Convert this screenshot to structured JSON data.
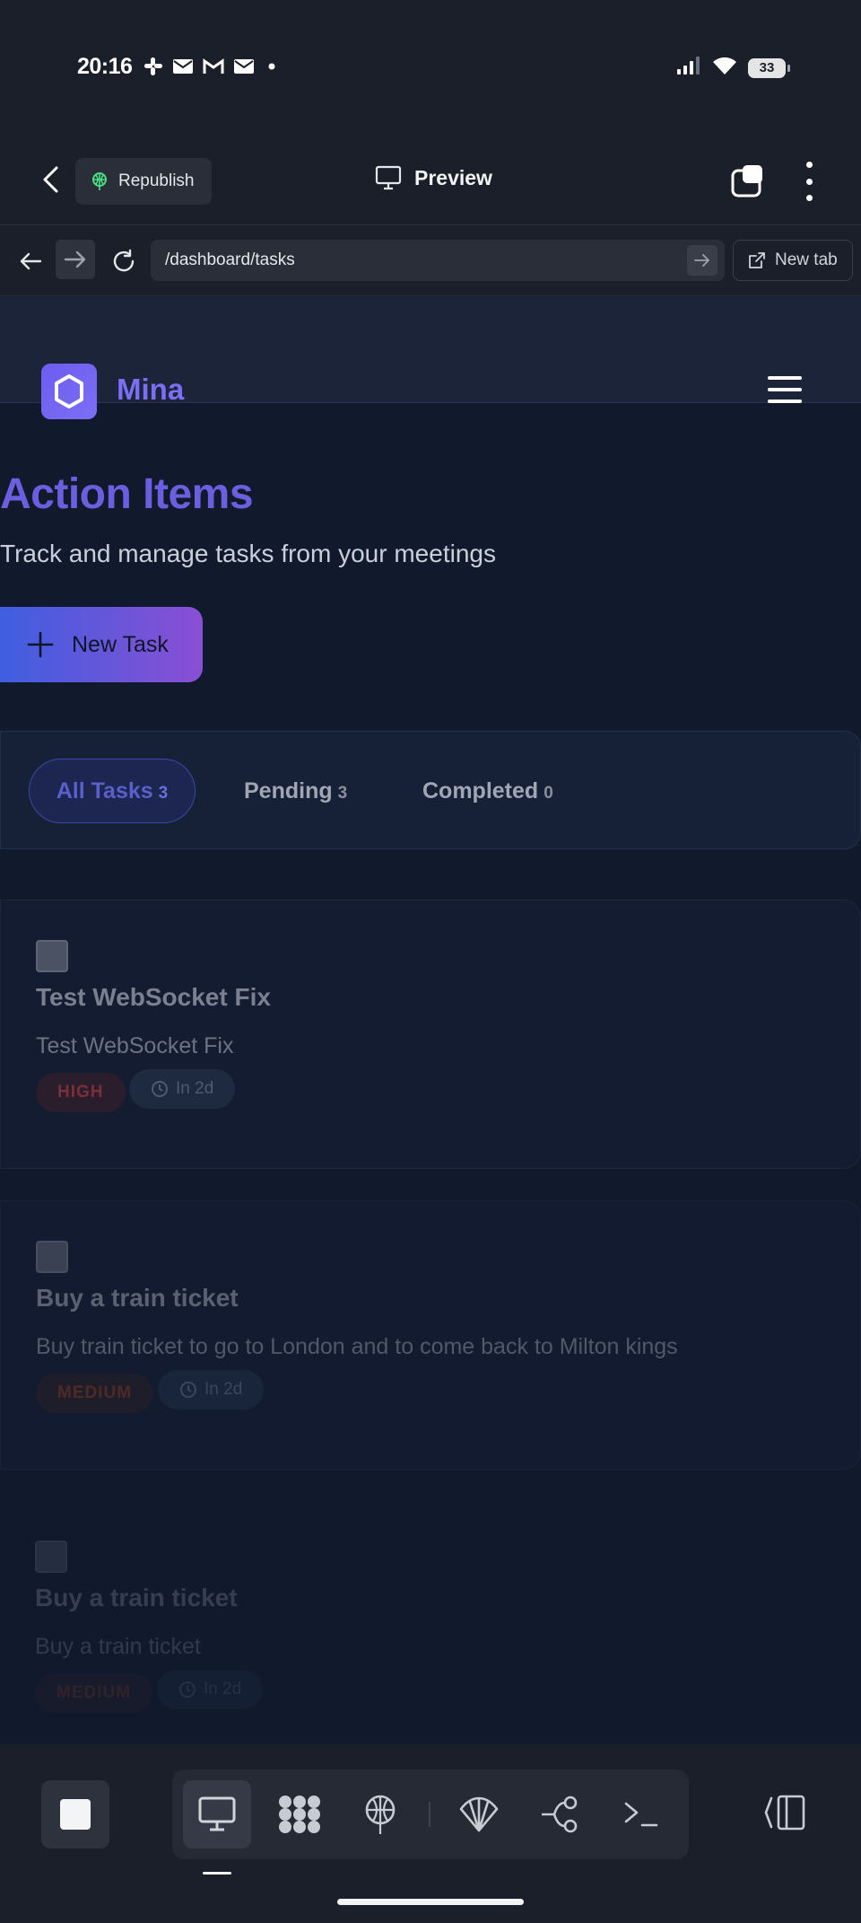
{
  "status_bar": {
    "time": "20:16",
    "battery": "33"
  },
  "app_header": {
    "republish_label": "Republish",
    "preview_label": "Preview"
  },
  "url_bar": {
    "url": "/dashboard/tasks",
    "new_tab_label": "New tab"
  },
  "site": {
    "brand": "Mina",
    "title": "Action Items",
    "subtitle": "Track and manage tasks from your meetings",
    "new_task_label": "New Task",
    "filters": [
      {
        "label": "All Tasks",
        "count": "3"
      },
      {
        "label": "Pending",
        "count": "3"
      },
      {
        "label": "Completed",
        "count": "0"
      }
    ],
    "tasks": [
      {
        "title": "Test WebSocket Fix",
        "description": "Test WebSocket Fix",
        "priority": "HIGH",
        "due": "In 2d"
      },
      {
        "title": "Buy a train ticket",
        "description": "Buy train ticket to go to London and to come back to Milton kings",
        "priority": "MEDIUM",
        "due": "In 2d"
      },
      {
        "title": "Buy a train ticket",
        "description": "Buy a train ticket",
        "priority": "MEDIUM",
        "due": "In 2d"
      }
    ]
  },
  "colors": {
    "accent": "#6b5fe0",
    "brand": "#7c6ff5",
    "button_gradient_start": "#3f5ee0",
    "button_gradient_end": "#8a4fd4",
    "background": "#111a2d"
  }
}
